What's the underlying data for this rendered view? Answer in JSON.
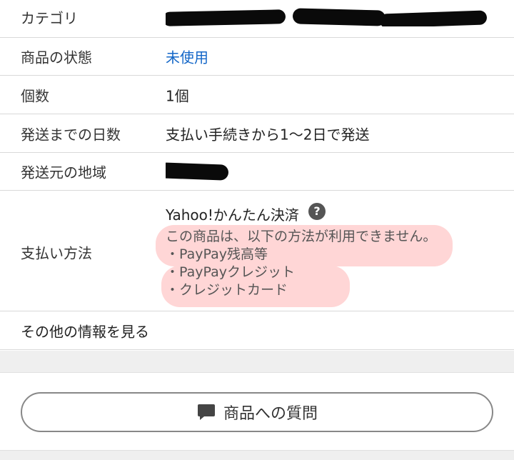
{
  "details": {
    "category": {
      "label": "カテゴリ",
      "value": ""
    },
    "condition": {
      "label": "商品の状態",
      "value": "未使用"
    },
    "quantity": {
      "label": "個数",
      "value": "1個"
    },
    "shipping_days": {
      "label": "発送までの日数",
      "value": "支払い手続きから1〜2日で発送"
    },
    "shipping_region": {
      "label": "発送元の地域",
      "value": ""
    },
    "payment": {
      "label": "支払い方法",
      "method": "Yahoo!かんたん決済",
      "help_icon": "question-circle-icon",
      "help_glyph": "?",
      "notice": "この商品は、以下の方法が利用できません。",
      "unavailable": [
        "・PayPay残高等",
        "・PayPayクレジット",
        "・クレジットカード"
      ]
    },
    "more_info": "その他の情報を見る"
  },
  "question_button": {
    "label": "商品への質問",
    "icon": "speech-bubble-icon"
  },
  "colors": {
    "link": "#1467c8",
    "highlight": "#ffd6d6",
    "border": "#d9d9d9"
  }
}
